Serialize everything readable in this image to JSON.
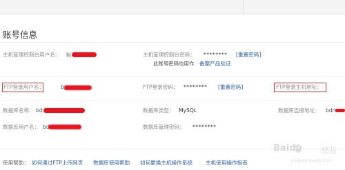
{
  "section_title": "账号信息",
  "row1": {
    "host_user_label": "主机管理控制台用户名：",
    "host_user_value_prefix": "bj",
    "host_pwd_label": "主机管理控制台密码：",
    "host_pwd_mask": "********",
    "host_pwd_reset": "[重置密码]",
    "note_text": "此账号密码也用作",
    "note_link": "备案产品验证"
  },
  "row2": {
    "ftp_user_label": "FTP登录用户名：",
    "ftp_user_value_prefix": "bj",
    "ftp_pwd_label": "FTP登录密码：",
    "ftp_pwd_mask": "********",
    "ftp_pwd_reset": "[重置密码]",
    "ftp_host_label": "FTP登录主机地址："
  },
  "row3": {
    "db_name_label": "数据库名称：",
    "db_name_value_prefix": "bd",
    "db_type_label": "数据库类型：",
    "db_type_value": "MySQL",
    "db_addr_label": "数据库连接地址：",
    "db_addr_value_prefix": "bdm"
  },
  "row4": {
    "db_user_label": "数据库用户名：",
    "db_user_value_prefix": "bd",
    "db_pwd_label": "数据库管理密码：",
    "db_pwd_mask": "********"
  },
  "footer": {
    "label": "使用帮助：",
    "links": [
      "如何通过FTP上传网页",
      "数据库使用帮助",
      "如何更换主机操作系统",
      "主机使用操作指南"
    ]
  },
  "watermark": {
    "brand": "Baidu",
    "sub": "经验",
    "url": "jingyan.baidu.com"
  },
  "colors": {
    "link": "#2a5fa8",
    "highlight_box": "#d23b3b",
    "redaction": "#e8141f"
  }
}
